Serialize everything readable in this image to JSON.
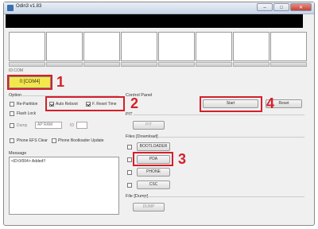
{
  "window": {
    "title": "Odin3 v1.83",
    "btn_min": "–",
    "btn_max": "□",
    "btn_close": "✕"
  },
  "id_label": "ID:COM",
  "com_port": "0:[COM4]",
  "option": {
    "header": "Option",
    "repartition": "Re-Partition",
    "auto_reboot": "Auto Reboot",
    "f_reset_time": "F. Reset Time",
    "flash_lock": "Flash Lock",
    "dump": "Dump",
    "dump_select": "AP RAM",
    "dump_field": "ID",
    "phone_efs_clear": "Phone EFS Clear",
    "phone_bootloader_update": "Phone Bootloader Update"
  },
  "message": {
    "header": "Message",
    "text": "<ID:0/004> Added!!"
  },
  "control_panel": {
    "header": "Control Panel",
    "start": "Start",
    "reset": "Reset"
  },
  "pit": {
    "header": "PIT",
    "button": "PIT"
  },
  "files": {
    "header": "Files [Download]",
    "bootloader": "BOOTLOADER",
    "pda": "PDA",
    "phone": "PHONE",
    "csc": "CSC"
  },
  "file_dump": {
    "header": "File [Dump]",
    "button": "DUMP"
  },
  "annotations": [
    "1",
    "2",
    "3",
    "4"
  ]
}
